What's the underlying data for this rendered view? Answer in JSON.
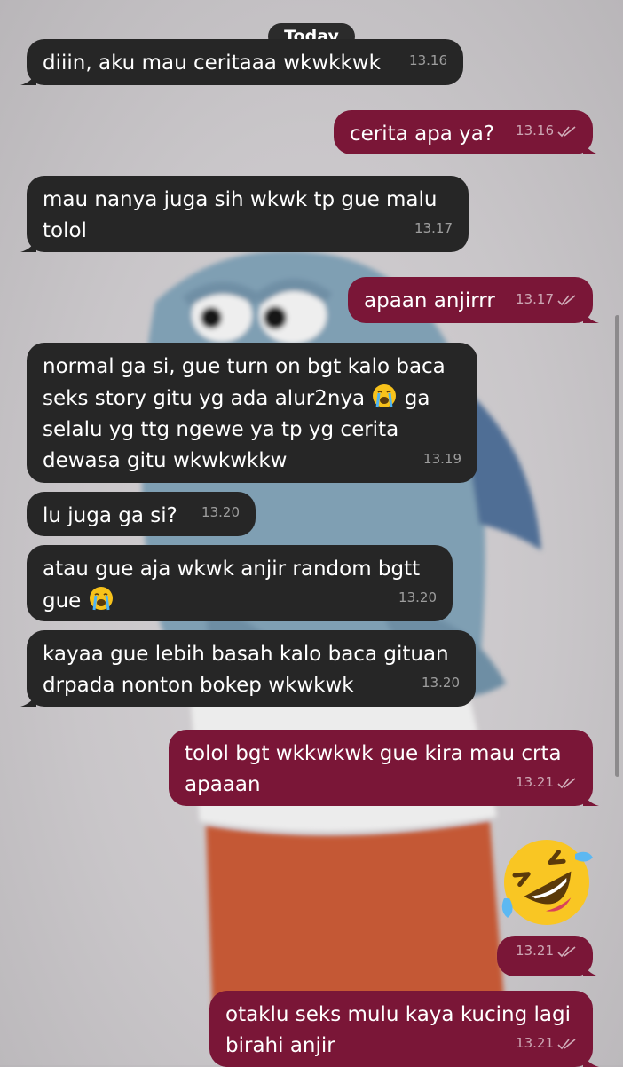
{
  "day_label": "Today",
  "messages": [
    {
      "dir": "in",
      "text": "diiin, aku mau ceritaaa wkwkkwk",
      "time": "13.16"
    },
    {
      "dir": "out",
      "text": "cerita apa ya?",
      "time": "13.16"
    },
    {
      "dir": "in",
      "text": "mau nanya juga sih wkwk tp gue malu\ntolol",
      "time": "13.17"
    },
    {
      "dir": "out",
      "text": "apaan anjirrr",
      "time": "13.17"
    },
    {
      "dir": "in",
      "text_a": "normal ga si, gue turn on bgt kalo baca\nseks story gitu yg ada alur2nya ",
      "emoji": "loudly-crying-face",
      "text_b": " ga\nselalu yg ttg ngewe ya tp yg cerita\ndewasa gitu wkwkwkkw",
      "time": "13.19"
    },
    {
      "dir": "in",
      "text": "lu juga ga si?",
      "time": "13.20"
    },
    {
      "dir": "in",
      "text_a": "atau gue aja wkwk anjir random bgtt\ngue ",
      "emoji": "loudly-crying-face",
      "time": "13.20"
    },
    {
      "dir": "in",
      "text": "kayaa gue lebih basah kalo baca gituan\ndrpada nonton bokep wkwkwk",
      "time": "13.20"
    },
    {
      "dir": "out",
      "text": "tolol bgt wkkwkwk gue kira mau crta\napaaan",
      "time": "13.21"
    },
    {
      "dir": "out",
      "emoji": "rolling-on-the-floor-laughing",
      "time": "13.21"
    },
    {
      "dir": "out",
      "text": "otaklu seks mulu kaya kucing lagi\nbirahi anjir",
      "time": "13.21"
    }
  ],
  "colors": {
    "incoming": "#262626",
    "outgoing": "#7a1637"
  }
}
